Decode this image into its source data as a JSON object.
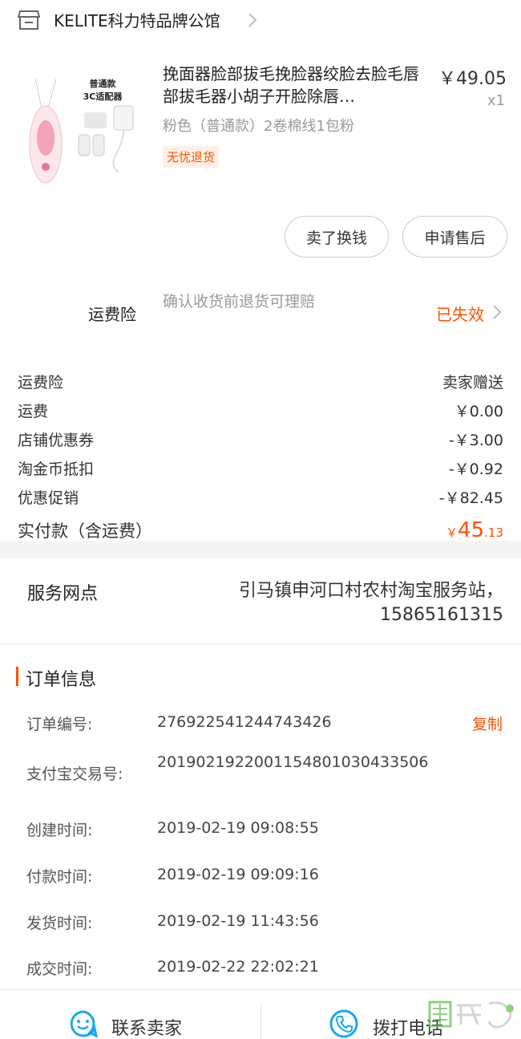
{
  "store": {
    "name": "KELITE科力特品牌公馆"
  },
  "product": {
    "title": "挽面器脸部拔毛挽脸器绞脸去脸毛唇部拔毛器小胡子开脸除唇…",
    "price": "￥49.05",
    "qty": "x1",
    "sku": "粉色（普通款）2卷棉线1包粉",
    "tag": "无忧退货",
    "image_caption_1": "普通款",
    "image_caption_2": "3C适配器"
  },
  "actions": {
    "sell": "卖了换钱",
    "after_sale": "申请售后"
  },
  "insurance": {
    "label": "运费险",
    "desc": "确认收货前退货可理赔",
    "status": "已失效"
  },
  "fees": [
    {
      "label": "运费险",
      "value": "卖家赠送"
    },
    {
      "label": "运费",
      "value": "￥0.00"
    },
    {
      "label": "店铺优惠券",
      "value": "-￥3.00"
    },
    {
      "label": "淘金币抵扣",
      "value": "-￥0.92"
    },
    {
      "label": "优惠促销",
      "value": "-￥82.45"
    }
  ],
  "paid": {
    "label": "实付款（含运费）",
    "currency": "￥",
    "integer": "45",
    "decimal": ".13"
  },
  "service": {
    "label": "服务网点",
    "value": "引马镇申河口村农村淘宝服务站，15865161315"
  },
  "order_info": {
    "title": "订单信息",
    "copy": "复制",
    "rows": [
      {
        "key": "订单编号:",
        "value": "276922541244743426"
      },
      {
        "key": "支付宝交易号:",
        "value": "2019021922001154801030433506"
      },
      {
        "key": "创建时间:",
        "value": "2019-02-19 09:08:55"
      },
      {
        "key": "付款时间:",
        "value": "2019-02-19 09:09:16"
      },
      {
        "key": "发货时间:",
        "value": "2019-02-19 11:43:56"
      },
      {
        "key": "成交时间:",
        "value": "2019-02-22 22:02:21"
      }
    ]
  },
  "bottom": {
    "contact": "联系卖家",
    "phone": "拨打电话"
  },
  "colors": {
    "accent": "#ff5000",
    "icon_blue": "#1aa8f0"
  }
}
